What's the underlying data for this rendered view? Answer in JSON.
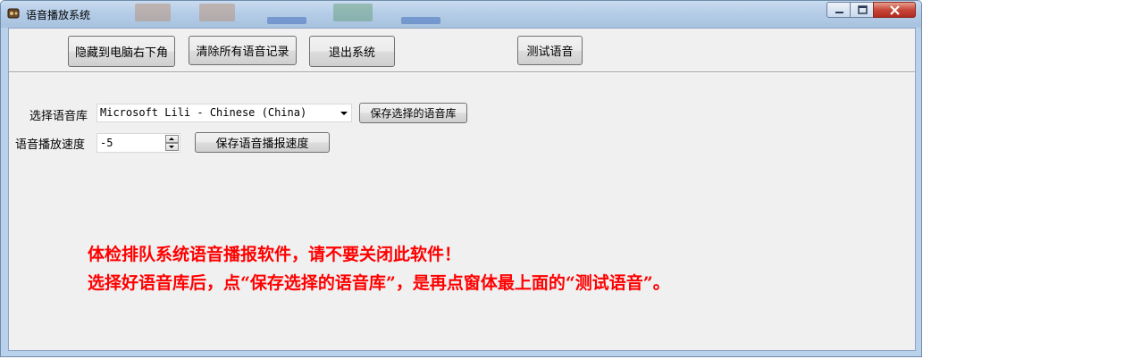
{
  "window": {
    "title": "语音播放系统",
    "icon": "app-icon",
    "controls": {
      "minimize": "minimize-icon",
      "maximize": "maximize-icon",
      "close": "close-icon"
    }
  },
  "toolbar": {
    "hide_label": "隐藏到电脑右下角",
    "clear_label": "清除所有语音记录",
    "exit_label": "退出系统",
    "test_label": "测试语音"
  },
  "settings": {
    "voice_label": "选择语音库",
    "voice_value": "Microsoft Lili - Chinese (China)",
    "save_voice_label": "保存选择的语音库",
    "speed_label": "语音播放速度",
    "speed_value": "-5",
    "save_speed_label": "保存语音播报速度"
  },
  "notice": {
    "line1": "体检排队系统语音播报软件，请不要关闭此软件！",
    "line2": "选择好语音库后，点“保存选择的语音库”，是再点窗体最上面的“测试语音”。"
  },
  "colors": {
    "notice": "#ff0000",
    "client_background": "#f0f0f0",
    "frame": "#b9d1ea",
    "close_button": "#c7473a"
  }
}
